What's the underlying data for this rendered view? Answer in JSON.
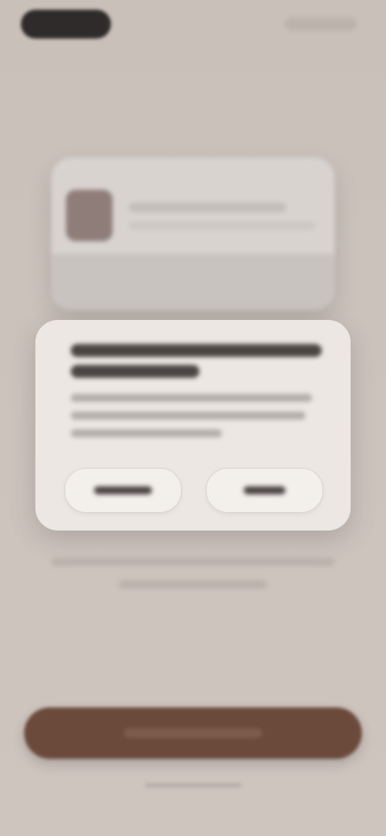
{
  "colors": {
    "background": "#cbc1bb",
    "dialog": "#ece7e2",
    "primary_button": "#6b4a3c",
    "top_pill": "#2f2b2a"
  },
  "icons": {
    "preview_thumbnail": "image-thumbnail"
  }
}
